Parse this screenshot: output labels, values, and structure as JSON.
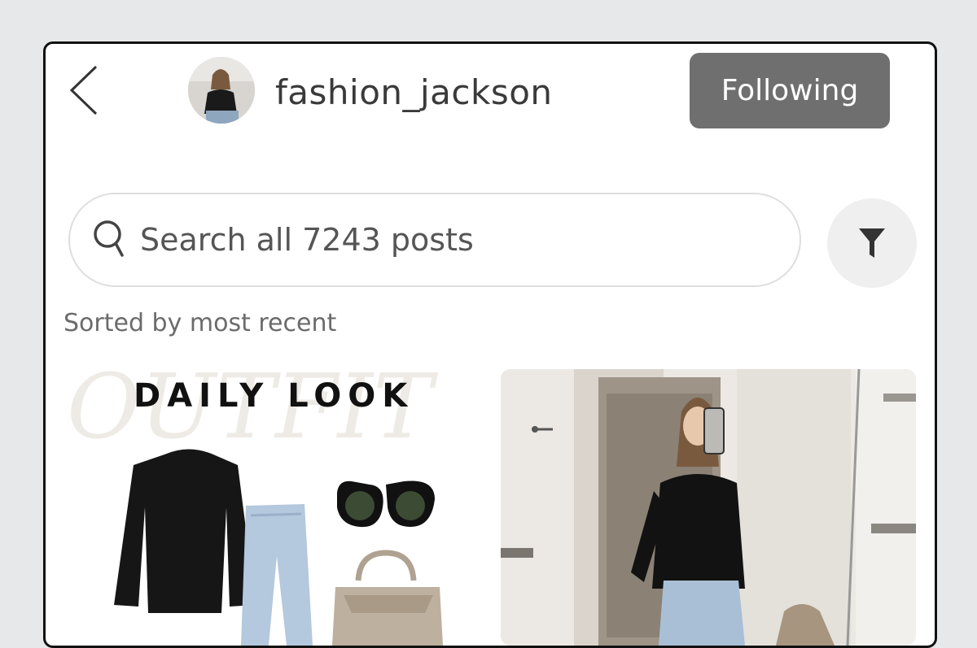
{
  "header": {
    "username": "fashion_jackson",
    "follow_label": "Following"
  },
  "search": {
    "placeholder": "Search all 7243 posts"
  },
  "sort": {
    "label": "Sorted by most recent"
  },
  "posts": [
    {
      "title": "DAILY LOOK",
      "watermark": "OUTFIT"
    },
    {
      "title": ""
    }
  ],
  "icons": {
    "back": "chevron-left-icon",
    "search": "search-icon",
    "filter": "filter-icon"
  },
  "colors": {
    "follow_bg": "#6f6f6f",
    "filter_bg": "#efefef",
    "page_bg": "#e6e8e9"
  }
}
